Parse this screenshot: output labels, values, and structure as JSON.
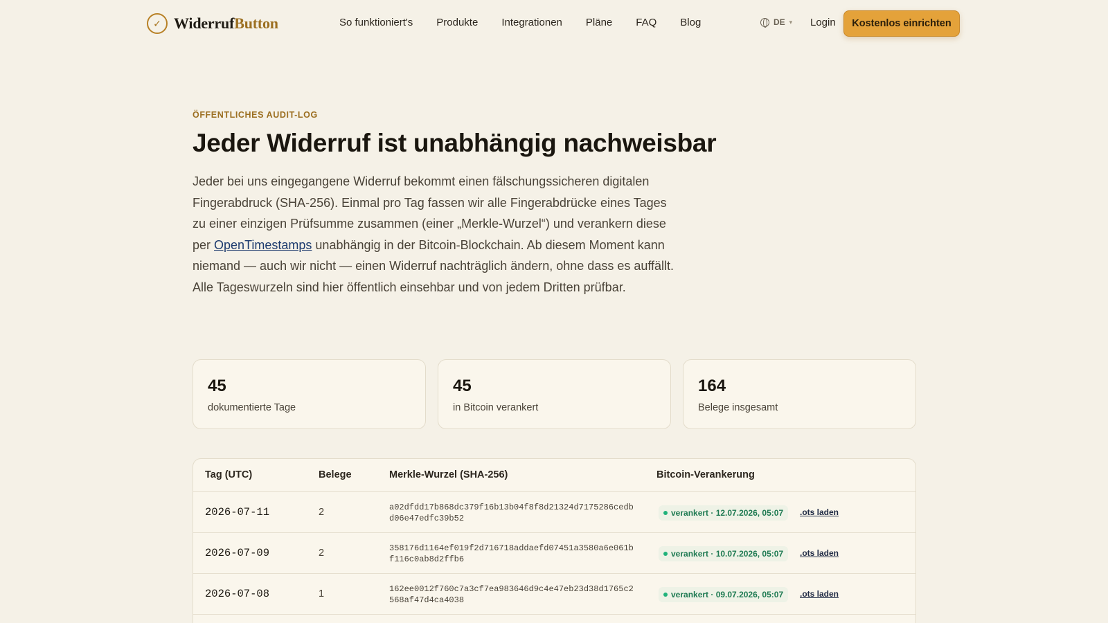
{
  "header": {
    "logo_part1": "Widerruf",
    "logo_part2": "Button",
    "nav": [
      "So funktioniert's",
      "Produkte",
      "Integrationen",
      "Pläne",
      "FAQ",
      "Blog"
    ],
    "lang": "DE",
    "login": "Login",
    "cta": "Kostenlos einrichten"
  },
  "hero": {
    "eyebrow": "ÖFFENTLICHES AUDIT-LOG",
    "title": "Jeder Widerruf ist unabhängig nachweisbar",
    "intro_before": "Jeder bei uns eingegangene Widerruf bekommt einen fälschungssicheren digitalen Fingerabdruck (SHA-256). Einmal pro Tag fassen wir alle Fingerabdrücke eines Tages zu einer einzigen Prüfsumme zusammen (einer „Merkle-Wurzel“) und verankern diese per ",
    "intro_link": "OpenTimestamps",
    "intro_after": " unabhängig in der Bitcoin-Blockchain. Ab diesem Moment kann niemand — auch wir nicht — einen Widerruf nachträglich ändern, ohne dass es auffällt. Alle Tageswurzeln sind hier öffentlich einsehbar und von jedem Dritten prüfbar."
  },
  "stats": [
    {
      "value": "45",
      "label": "dokumentierte Tage"
    },
    {
      "value": "45",
      "label": "in Bitcoin verankert"
    },
    {
      "value": "164",
      "label": "Belege insgesamt"
    }
  ],
  "table": {
    "headers": [
      "Tag (UTC)",
      "Belege",
      "Merkle-Wurzel (SHA-256)",
      "Bitcoin-Verankerung"
    ],
    "rows": [
      {
        "day": "2026-07-11",
        "count": "2",
        "hash": "a02dfdd17b868dc379f16b13b04f8f8d21324d7175286cedbd06e47edfc39b52",
        "status": "verankert · 12.07.2026, 05:07",
        "link": ".ots laden"
      },
      {
        "day": "2026-07-09",
        "count": "2",
        "hash": "358176d1164ef019f2d716718addaefd07451a3580a6e061bf116c0ab8d2ffb6",
        "status": "verankert · 10.07.2026, 05:07",
        "link": ".ots laden"
      },
      {
        "day": "2026-07-08",
        "count": "1",
        "hash": "162ee0012f760c7a3cf7ea983646d9c4e47eb23d38d1765c2568af47d4ca4038",
        "status": "verankert · 09.07.2026, 05:07",
        "link": ".ots laden"
      }
    ]
  }
}
